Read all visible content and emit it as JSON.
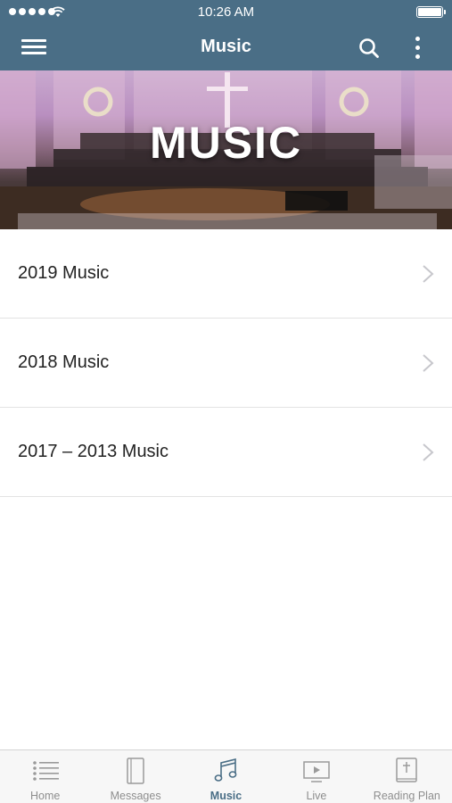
{
  "status_bar": {
    "time": "10:26 AM"
  },
  "nav": {
    "title": "Music"
  },
  "banner": {
    "title": "MUSIC"
  },
  "list": [
    {
      "label": "2019 Music"
    },
    {
      "label": "2018 Music"
    },
    {
      "label": "2017 – 2013 Music"
    }
  ],
  "tabs": [
    {
      "label": "Home",
      "icon": "list-icon",
      "active": false
    },
    {
      "label": "Messages",
      "icon": "book-icon",
      "active": false
    },
    {
      "label": "Music",
      "icon": "music-note-icon",
      "active": true
    },
    {
      "label": "Live",
      "icon": "play-screen-icon",
      "active": false
    },
    {
      "label": "Reading Plan",
      "icon": "bible-icon",
      "active": false
    }
  ],
  "colors": {
    "header": "#4a6e86",
    "active_tab": "#4a6e86",
    "inactive_tab": "#8e8e8e"
  }
}
